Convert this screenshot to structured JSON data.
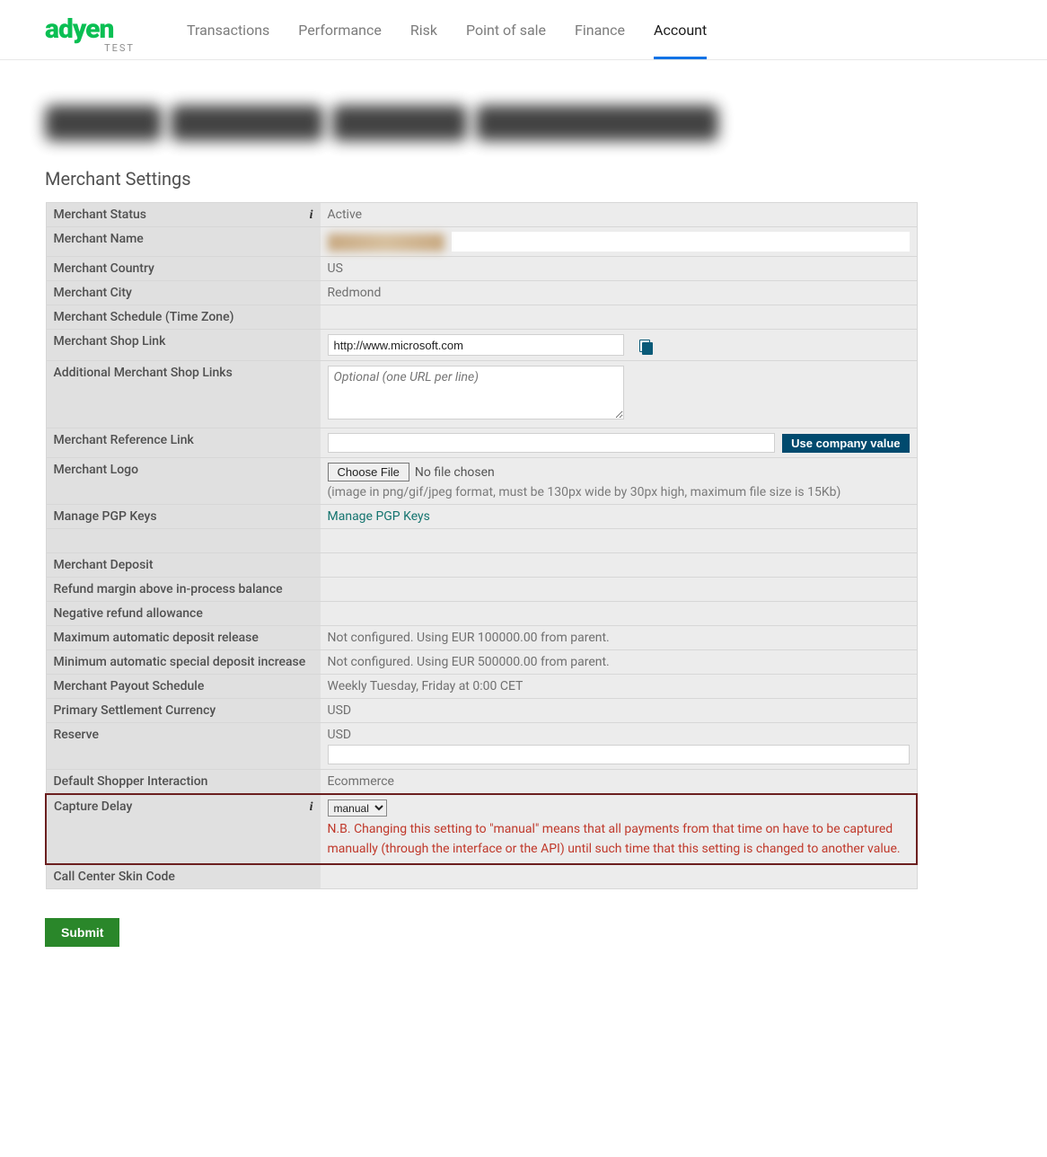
{
  "brand": {
    "name": "adyen",
    "tag": "TEST"
  },
  "nav": [
    {
      "label": "Transactions",
      "active": false
    },
    {
      "label": "Performance",
      "active": false
    },
    {
      "label": "Risk",
      "active": false
    },
    {
      "label": "Point of sale",
      "active": false
    },
    {
      "label": "Finance",
      "active": false
    },
    {
      "label": "Account",
      "active": true
    }
  ],
  "section_title": "Merchant Settings",
  "rows": {
    "status": {
      "label": "Merchant Status",
      "value": "Active",
      "info": true
    },
    "name": {
      "label": "Merchant Name"
    },
    "country": {
      "label": "Merchant Country",
      "value": "US"
    },
    "city": {
      "label": "Merchant City",
      "value": "Redmond"
    },
    "schedule": {
      "label": "Merchant Schedule (Time Zone)",
      "value": ""
    },
    "shop_link": {
      "label": "Merchant Shop Link",
      "value": "http://www.microsoft.com"
    },
    "additional_links": {
      "label": "Additional Merchant Shop Links",
      "placeholder": "Optional (one URL per line)"
    },
    "ref_link": {
      "label": "Merchant Reference Link",
      "button": "Use company value"
    },
    "logo": {
      "label": "Merchant Logo",
      "choose": "Choose File",
      "nofile": "No file chosen",
      "hint": "(image in png/gif/jpeg format, must be 130px wide by 30px high, maximum file size is 15Kb)"
    },
    "pgp": {
      "label": "Manage PGP Keys",
      "link": "Manage PGP Keys"
    },
    "deposit": {
      "label": "Merchant Deposit",
      "value": ""
    },
    "refund_margin": {
      "label": "Refund margin above in-process balance",
      "value": ""
    },
    "neg_refund": {
      "label": "Negative refund allowance",
      "value": ""
    },
    "max_auto_deposit": {
      "label": "Maximum automatic deposit release",
      "value": "Not configured. Using EUR 100000.00 from parent."
    },
    "min_auto_special": {
      "label": "Minimum automatic special deposit increase",
      "value": "Not configured. Using EUR 500000.00 from parent."
    },
    "payout_schedule": {
      "label": "Merchant Payout Schedule",
      "value": "Weekly Tuesday, Friday at 0:00 CET"
    },
    "settlement_currency": {
      "label": "Primary Settlement Currency",
      "value": "USD"
    },
    "reserve": {
      "label": "Reserve",
      "value": "USD"
    },
    "shopper_interaction": {
      "label": "Default Shopper Interaction",
      "value": "Ecommerce"
    },
    "capture_delay": {
      "label": "Capture Delay",
      "selected": "manual",
      "info": true,
      "warning": "N.B. Changing this setting to \"manual\" means that all payments from that time on have to be captured manually (through the interface or the API) until such time that this setting is changed to another value."
    },
    "skin_code": {
      "label": "Call Center Skin Code",
      "value": ""
    }
  },
  "submit": "Submit"
}
